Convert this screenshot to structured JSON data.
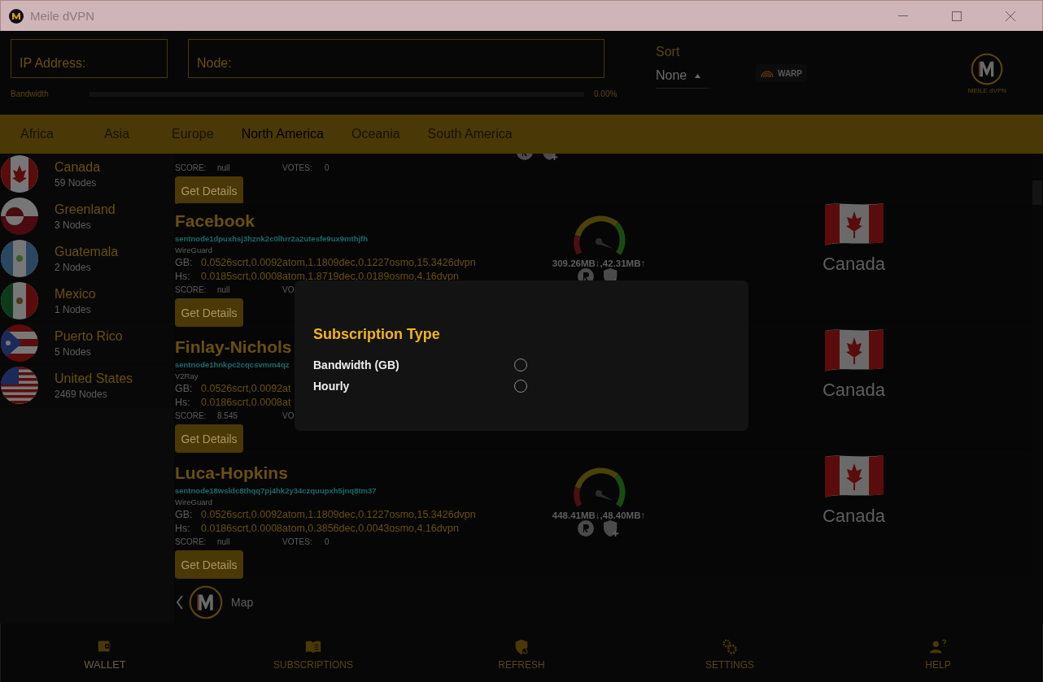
{
  "window": {
    "title": "Meile dVPN"
  },
  "search": {
    "ip_placeholder": "IP Address:",
    "node_placeholder": "Node:"
  },
  "sort": {
    "label": "Sort",
    "value": "None"
  },
  "warp_button": {
    "label": "WARP"
  },
  "logo": {
    "caption": "MEILE dVPN"
  },
  "bandwidth": {
    "label": "Bandwidth",
    "level": 0,
    "reading": "0.00%"
  },
  "tabs": [
    {
      "label": "Africa",
      "selected": false
    },
    {
      "label": "Asia",
      "selected": false
    },
    {
      "label": "Europe",
      "selected": false
    },
    {
      "label": "North America",
      "selected": true
    },
    {
      "label": "Oceania",
      "selected": false
    },
    {
      "label": "South America",
      "selected": false
    }
  ],
  "countries": [
    {
      "kind": "canada",
      "name": "Canada",
      "nodes": "59 Nodes"
    },
    {
      "kind": "greenland",
      "name": "Greenland",
      "nodes": "3 Nodes"
    },
    {
      "kind": "guatemala",
      "name": "Guatemala",
      "nodes": "2 Nodes"
    },
    {
      "kind": "mexico",
      "name": "Mexico",
      "nodes": "1 Nodes"
    },
    {
      "kind": "puerto-rico",
      "name": "Puerto Rico",
      "nodes": "5 Nodes"
    },
    {
      "kind": "usa",
      "name": "United States",
      "nodes": "2469 Nodes"
    }
  ],
  "nodes": [
    {
      "kind": "partial",
      "score_label": "SCORE:",
      "score": "null",
      "votes_label": "VOTES:",
      "votes": "0",
      "button": "Get Details"
    },
    {
      "kind": "full",
      "name": "Facebook",
      "address": "sentnode1dpuxhsj3hznk2c0lhrr2a2utesfe9ux9mthjfh",
      "protocol": "WireGuard",
      "rows": [
        {
          "label": "GB:",
          "value": "0.0526scrt,0.0092atom,1.1809dec,0.1227osmo,15.3426dvpn"
        },
        {
          "label": "Hs:",
          "value": "0.0185scrt,0.0008atom,1.8719dec,0.0189osmo,4.16dvpn"
        }
      ],
      "score_label": "SCORE:",
      "score": "null",
      "votes_label": "VO",
      "button": "Get Details",
      "traffic": "309.26MB↓,42.31MB↑",
      "country": "Canada"
    },
    {
      "kind": "full",
      "name": "Finlay-Nichols",
      "address": "sentnode1hnkpc2cqcsvmm4qz",
      "protocol": "V2Ray",
      "rows": [
        {
          "label": "GB:",
          "value": "0.0526scrt,0.0092at"
        },
        {
          "label": "Hs:",
          "value": "0.0186scrt,0.0008at"
        }
      ],
      "score_label": "SCORE:",
      "score": "8.545",
      "votes_label": "VO",
      "button": "Get Details",
      "country": "Canada"
    },
    {
      "kind": "full",
      "name": "Luca-Hopkins",
      "address": "sentnode18wsldc8thqq7pj4hk2y34czquupxh5jnq8tm37",
      "protocol": "WireGuard",
      "rows": [
        {
          "label": "GB:",
          "value": "0.0526scrt,0.0092atom,1.1809dec,0.1227osmo,15.3426dvpn"
        },
        {
          "label": "Hs:",
          "value": "0.0186scrt,0.0008atom,0.3856dec,0.0043osmo,4.16dvpn"
        }
      ],
      "score_label": "SCORE:",
      "score": "null",
      "votes_label": "VOTES:",
      "votes": "0",
      "button": "Get Details",
      "traffic": "448.41MB↓,48.40MB↑",
      "country": "Canada"
    }
  ],
  "map_bar": {
    "label": "Map"
  },
  "bottom_nav": [
    {
      "kind": "wallet",
      "label": "WALLET",
      "selected": true
    },
    {
      "kind": "subscriptions",
      "label": "SUBSCRIPTIONS",
      "selected": false
    },
    {
      "kind": "refresh",
      "label": "REFRESH",
      "selected": false
    },
    {
      "kind": "settings",
      "label": "SETTINGS",
      "selected": false
    },
    {
      "kind": "help",
      "label": "HELP",
      "selected": false
    }
  ],
  "dialog": {
    "title": "Subscription Type",
    "options": [
      {
        "label": "Bandwidth (GB)",
        "selected": false
      },
      {
        "label": "Hourly",
        "selected": false
      }
    ]
  }
}
